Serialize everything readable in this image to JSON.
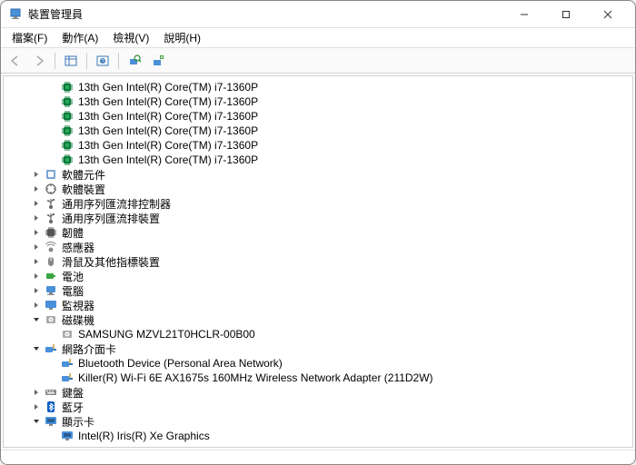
{
  "window": {
    "title": "裝置管理員"
  },
  "menubar": {
    "file": "檔案(F)",
    "action": "動作(A)",
    "view": "檢視(V)",
    "help": "說明(H)"
  },
  "tree": {
    "cpu_items": [
      "13th Gen Intel(R) Core(TM) i7-1360P",
      "13th Gen Intel(R) Core(TM) i7-1360P",
      "13th Gen Intel(R) Core(TM) i7-1360P",
      "13th Gen Intel(R) Core(TM) i7-1360P",
      "13th Gen Intel(R) Core(TM) i7-1360P",
      "13th Gen Intel(R) Core(TM) i7-1360P"
    ],
    "soft_components": "軟體元件",
    "soft_devices": "軟體裝置",
    "usb_hub_controllers": "通用序列匯流排控制器",
    "usb_hub_devices": "通用序列匯流排裝置",
    "firmware": "韌體",
    "sensors": "感應器",
    "mice": "滑鼠及其他指標裝置",
    "batteries": "電池",
    "computers": "電腦",
    "monitors": "監視器",
    "disk_drives": "磁碟機",
    "disk_item": "SAMSUNG MZVL21T0HCLR-00B00",
    "net_adapters": "網路介面卡",
    "net_items": [
      "Bluetooth Device (Personal Area Network)",
      "Killer(R) Wi-Fi 6E AX1675s 160MHz Wireless Network Adapter (211D2W)"
    ],
    "keyboards": "鍵盤",
    "bluetooth": "藍牙",
    "display_adapters": "顯示卡",
    "display_item": "Intel(R) Iris(R) Xe Graphics"
  }
}
